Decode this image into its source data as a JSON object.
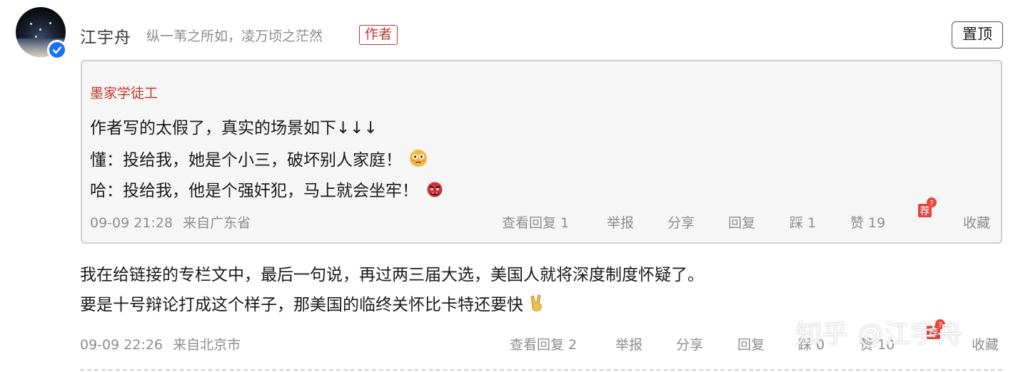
{
  "comment": {
    "author_name": "江宇舟",
    "author_bio": "纵一苇之所如，凌万顷之茫然",
    "author_tag": "作者",
    "pin_label": "置顶",
    "quote": {
      "author": "墨家学徒工",
      "lines": [
        "作者写的太假了，真实的场景如下↓↓↓",
        "懂：投给我，她是个小三，破坏别人家庭！",
        "哈：投给我，他是个强奸犯，马上就会坐牢！"
      ],
      "meta_time": "09-09 21:28",
      "meta_location": "来自广东省",
      "actions": {
        "view_replies": "查看回复 1",
        "report": "举报",
        "share": "分享",
        "reply": "回复",
        "dislike": "踩 1",
        "like": "赞 19",
        "collect": "收藏"
      },
      "icons": {
        "emoji_1": "flushed-face-icon",
        "emoji_2": "ogre-face-icon",
        "recommend": "recommend-icon"
      }
    },
    "body": [
      "我在给链接的专栏文中，最后一句说，再过两三届大选，美国人就将深度制度怀疑了。",
      "要是十号辩论打成这个样子，那美国的临终关怀比卡特还要快"
    ],
    "body_emoji": "victory-hand-icon",
    "meta_time": "09-09 22:26",
    "meta_location": "来自北京市",
    "actions": {
      "view_replies": "查看回复 2",
      "report": "举报",
      "share": "分享",
      "reply": "回复",
      "dislike": "踩 0",
      "like": "赞 10",
      "collect": "收藏"
    }
  },
  "watermark": "知乎 @江宇舟",
  "colors": {
    "accent_red": "#c0392b",
    "verified_blue": "#1772f6",
    "meta_gray": "#8e8e8e"
  }
}
